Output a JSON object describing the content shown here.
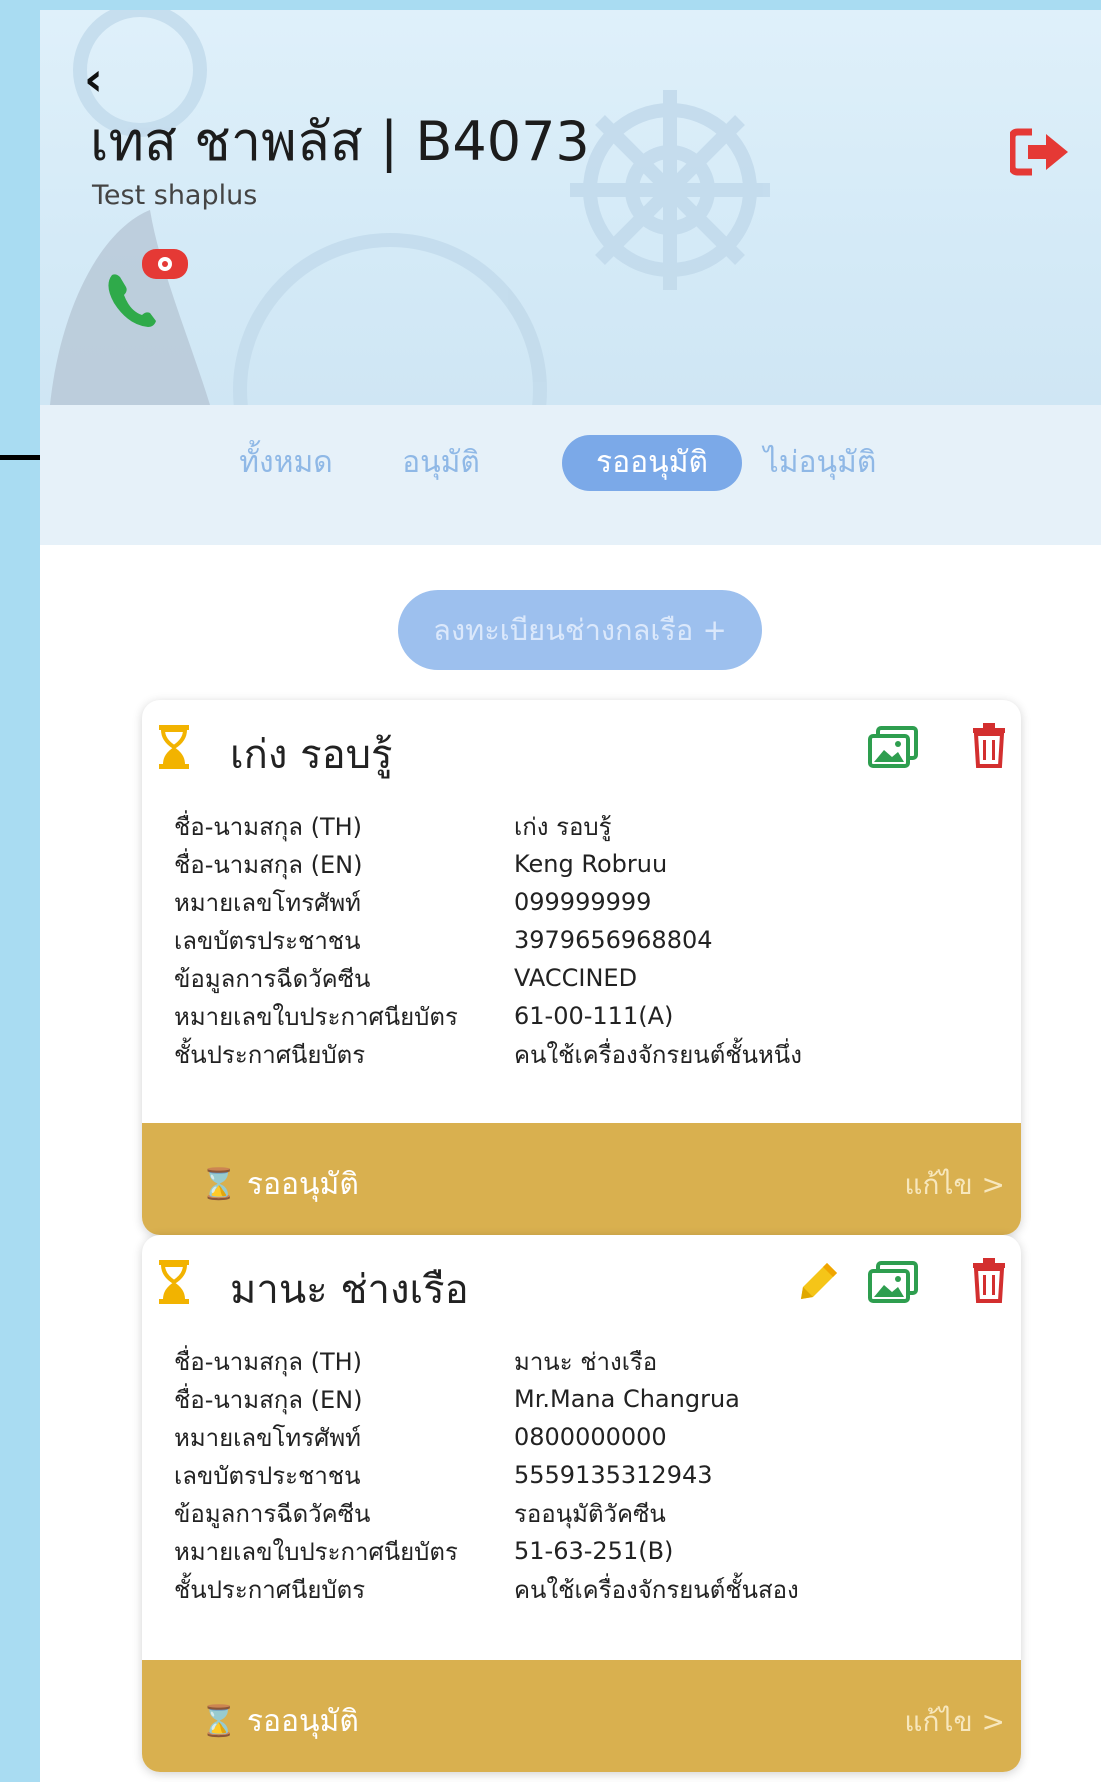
{
  "header": {
    "title": "เทส ชาพลัส | B4073",
    "subtitle": "Test shaplus"
  },
  "tabs": [
    {
      "label": "ทั้งหมด",
      "active": false
    },
    {
      "label": "อนุมัติ",
      "active": false
    },
    {
      "label": "รออนุมัติ",
      "active": true
    },
    {
      "label": "ไม่อนุมัติ",
      "active": false
    }
  ],
  "register_label": "ลงทะเบียนช่างกลเรือ +",
  "field_labels": [
    "ชื่อ-นามสกุล (TH)",
    "ชื่อ-นามสกุล (EN)",
    "หมายเลขโทรศัพท์",
    "เลขบัตรประชาชน",
    "ข้อมูลการฉีดวัคซีน",
    "หมายเลขใบประกาศนียบัตร",
    "ชั้นประกาศนียบัตร"
  ],
  "cards": [
    {
      "name": "เก่ง รอบรู้",
      "values": [
        "เก่ง รอบรู้",
        "Keng Robruu",
        "099999999",
        "3979656968804",
        "VACCINED",
        "61-00-111(A)",
        "คนใช้เครื่องจักรยนต์ชั้นหนึ่ง"
      ],
      "status": "รออนุมัติ",
      "edit_label": "แก้ไข >"
    },
    {
      "name": "มานะ ช่างเรือ",
      "values": [
        "มานะ ช่างเรือ",
        "Mr.Mana Changrua",
        "0800000000",
        "5559135312943",
        "รออนุมัติวัคซีน",
        "51-63-251(B)",
        "คนใช้เครื่องจักรยนต์ชั้นสอง"
      ],
      "status": "รออนุมัติ",
      "edit_label": "แก้ไข >"
    }
  ],
  "colors": {
    "accent_blue": "#7ba9e8",
    "card_footer": "#d9b04f",
    "exit_red": "#e53935",
    "image_green": "#2e9e4f",
    "trash_red": "#d32f2f"
  }
}
